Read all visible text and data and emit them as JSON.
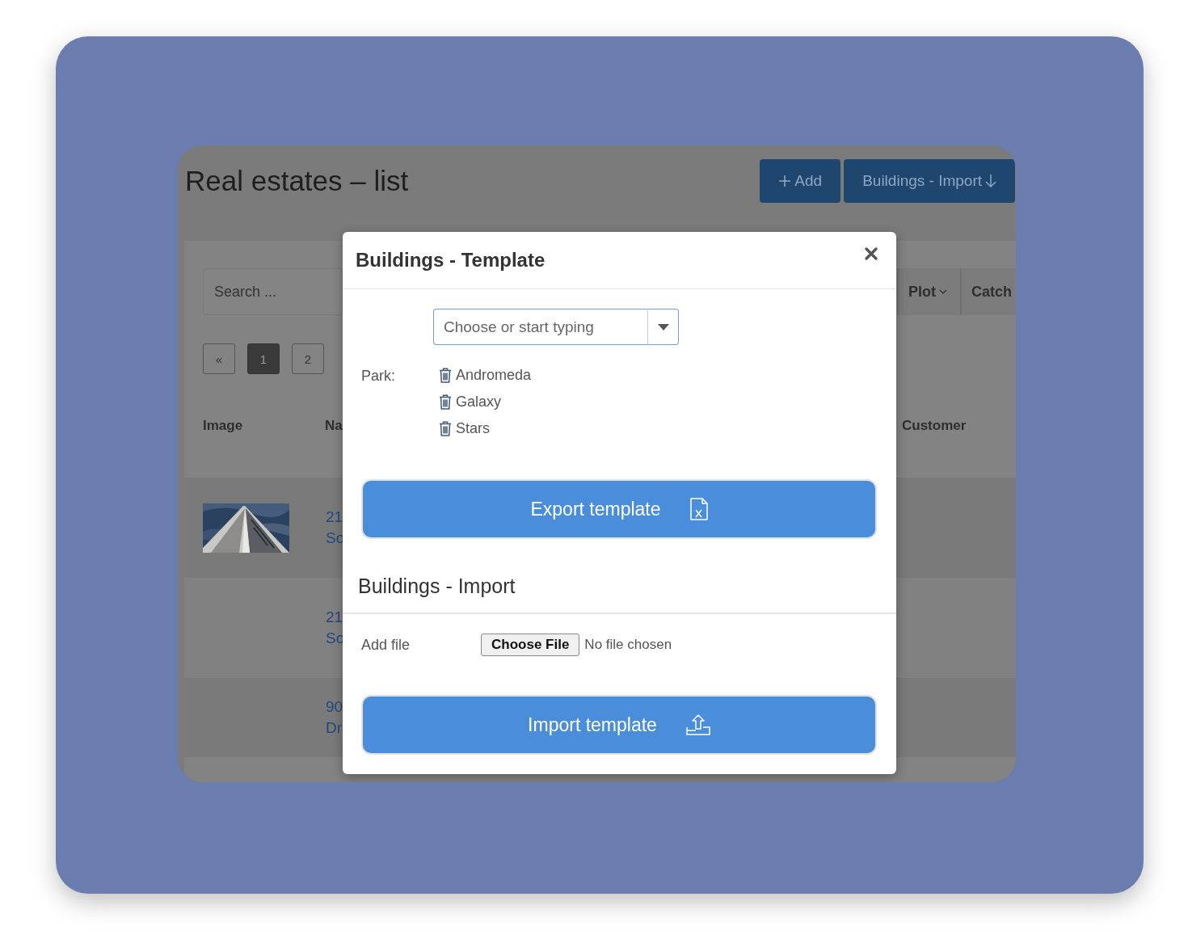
{
  "app": {
    "title": "Real estates – list",
    "add_button": {
      "label": "Add"
    },
    "import_button": {
      "label": "Buildings - Import"
    },
    "search": {
      "placeholder": "Search ..."
    },
    "filters": [
      {
        "label": "Plot",
        "dropdown": true
      },
      {
        "label": "Catch",
        "dropdown": false
      }
    ],
    "pagination": [
      {
        "label": "«",
        "selected": false
      },
      {
        "label": "1",
        "selected": true
      },
      {
        "label": "2",
        "selected": false
      }
    ],
    "table": {
      "columns": [
        "Image",
        "Na",
        "Customer"
      ],
      "rows": [
        {
          "image": {
            "kind": "picture"
          },
          "name_lines": [
            "21",
            "So"
          ]
        },
        {
          "name_lines": [
            "21",
            "So"
          ]
        },
        {
          "name_lines": [
            "90",
            "Dr"
          ]
        }
      ]
    }
  },
  "modal": {
    "title": "Buildings - Template",
    "park_select": {
      "placeholder": "Choose or start typing"
    },
    "park_label": "Park:",
    "parks": [
      "Andromeda",
      "Galaxy",
      "Stars"
    ],
    "export_button": "Export template",
    "import_title": "Buildings - Import",
    "file_label": "Add file",
    "file_button": "Choose File",
    "file_status": "No file chosen",
    "import_button": "Import template"
  }
}
